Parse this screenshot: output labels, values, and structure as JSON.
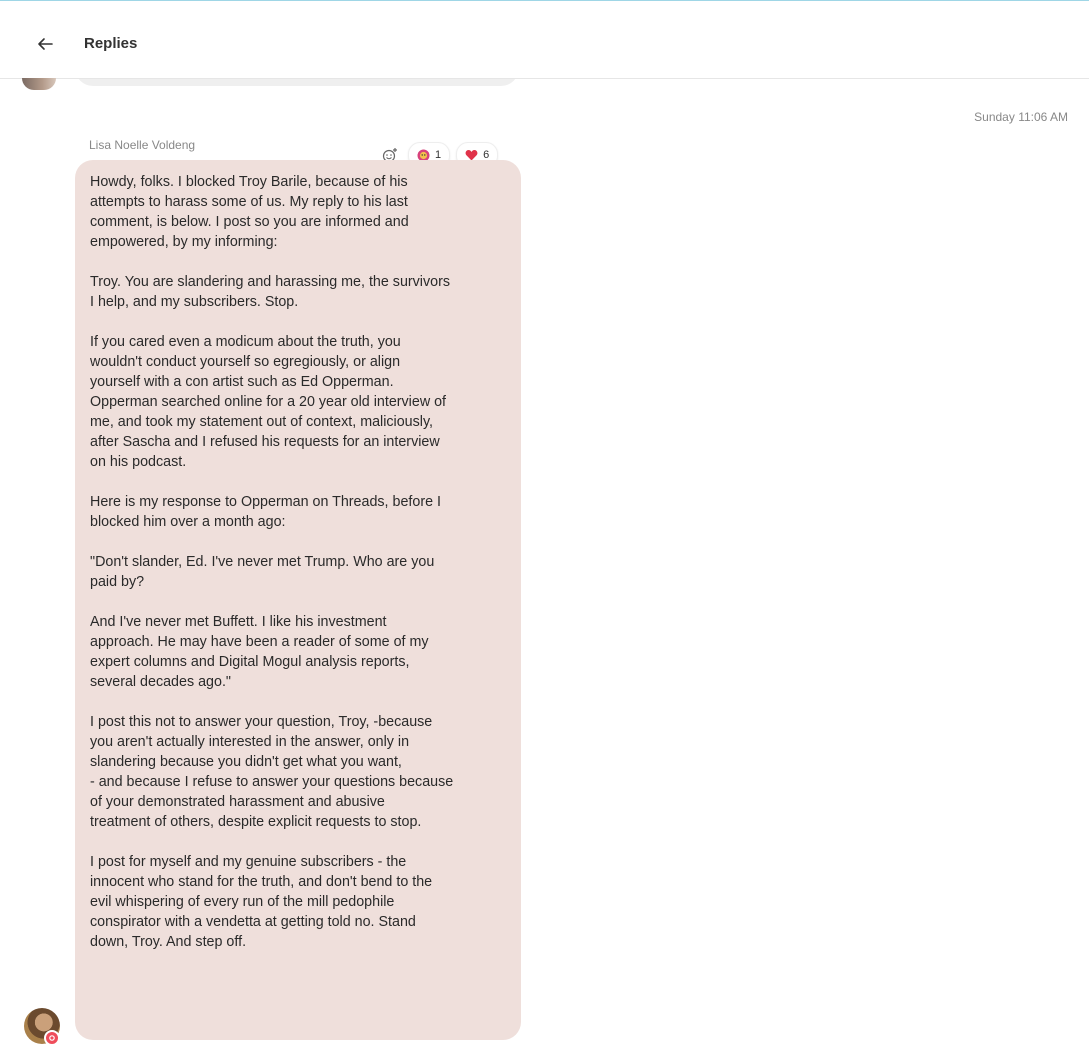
{
  "header": {
    "title": "Replies"
  },
  "thread": {
    "timestamp": "Sunday 11:06 AM",
    "message": {
      "sender": "Lisa Noelle Voldeng",
      "reactions": [
        {
          "emoji": "face-icon",
          "count": "1"
        },
        {
          "emoji": "heart-icon",
          "count": "6"
        }
      ],
      "paragraphs": [
        "Howdy, folks. I blocked Troy Barile, because of his\nattempts to harass some of us. My reply to his last\ncomment, is below. I post so you are informed and\nempowered, by my informing:",
        "Troy. You are slandering and harassing me, the survivors\nI help, and my subscribers. Stop.",
        "If you cared even a modicum about the truth, you\nwouldn't conduct yourself so egregiously, or align\nyourself with a con artist such as Ed Opperman.\nOpperman searched online for a 20 year old interview of\nme, and took my statement out of context, maliciously,\nafter Sascha and I refused his requests for an interview\non his podcast.",
        "Here is my response to Opperman on Threads, before I\nblocked him over a month ago:",
        "\"Don't slander, Ed. I've never met Trump. Who are you\npaid by?",
        "And I've never met Buffett. I like his investment\napproach. He may have been a reader of some of my\nexpert columns and Digital Mogul analysis reports,\nseveral decades ago.\"",
        "I post this not to answer your question, Troy, -because\nyou aren't actually interested in the answer, only in\nslandering because you didn't get what you want,\n- and because I refuse to answer your questions because\nof your demonstrated harassment and abusive\ntreatment of others, despite explicit requests to stop.",
        "I post for myself and my genuine subscribers - the\ninnocent who stand for the truth, and don't bend to the\nevil whispering of every run of the mill pedophile\nconspirator with a vendetta at getting told no. Stand\ndown, Troy. And step off."
      ]
    }
  },
  "colors": {
    "bubble": "#efdfdb",
    "heart": "#e0334a",
    "accent_line": "#9fd6e6"
  }
}
